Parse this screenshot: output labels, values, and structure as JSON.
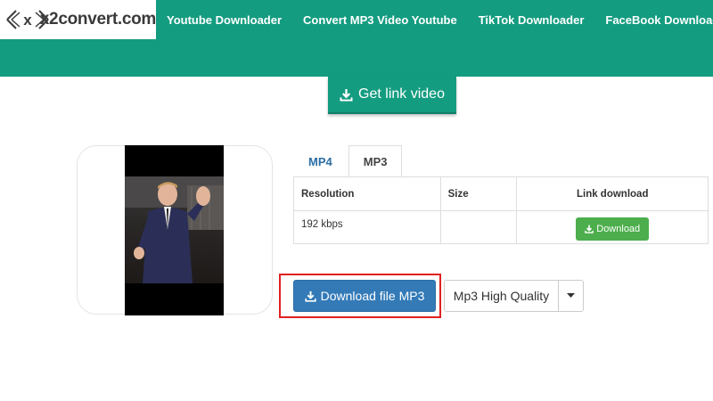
{
  "logo": {
    "text": "x2convert.com",
    "mark_letter": "x"
  },
  "nav": {
    "items": [
      {
        "label": "Youtube Downloader"
      },
      {
        "label": "Convert MP3 Video Youtube"
      },
      {
        "label": "TikTok Downloader"
      },
      {
        "label": "FaceBook Downloader"
      }
    ]
  },
  "get_link": {
    "label": "Get link video",
    "icon": "download-icon"
  },
  "tabs": [
    {
      "label": "MP4",
      "active": false
    },
    {
      "label": "MP3",
      "active": true
    }
  ],
  "table": {
    "headers": [
      "Resolution",
      "Size",
      "Link download"
    ],
    "rows": [
      {
        "resolution": "192 kbps",
        "size": "",
        "button_label": "Download"
      }
    ]
  },
  "actions": {
    "download_mp3_label": "Download file MP3",
    "quality_selected": "Mp3 High Quality"
  },
  "colors": {
    "brand_teal": "#149c80",
    "primary_blue": "#337ab7",
    "success_green": "#4cae4c",
    "highlight_red": "#e02020"
  }
}
